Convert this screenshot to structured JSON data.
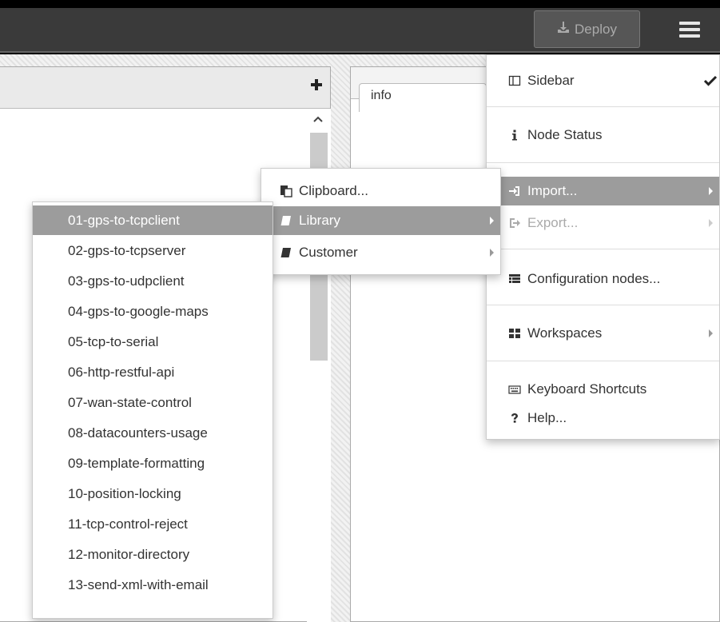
{
  "header": {
    "deploy_label": "Deploy",
    "deploy_icon": "download-tray-icon",
    "menu_icon": "hamburger-icon"
  },
  "left_panel": {
    "add_icon": "plus-icon"
  },
  "right_panel": {
    "tab_label": "info"
  },
  "main_menu": {
    "items": [
      {
        "label": "Sidebar",
        "icon": "columns-icon",
        "checked": true
      },
      {
        "label": "Node Status",
        "icon": "info-icon"
      },
      {
        "label": "Import...",
        "icon": "sign-in-icon",
        "submenu": true,
        "active": true
      },
      {
        "label": "Export...",
        "icon": "sign-out-icon",
        "submenu": true,
        "disabled": true
      },
      {
        "label": "Configuration nodes...",
        "icon": "table-icon"
      },
      {
        "label": "Workspaces",
        "icon": "grid-icon",
        "submenu": true
      },
      {
        "label": "Keyboard Shortcuts",
        "icon": "keyboard-icon"
      },
      {
        "label": "Help...",
        "icon": "question-icon"
      }
    ]
  },
  "import_menu": {
    "items": [
      {
        "label": "Clipboard...",
        "icon": "clipboard-icon"
      },
      {
        "label": "Library",
        "icon": "book-icon",
        "submenu": true,
        "active": true
      },
      {
        "label": "Customer",
        "icon": "book-icon",
        "submenu": true
      }
    ]
  },
  "library_menu": {
    "items": [
      "01-gps-to-tcpclient",
      "02-gps-to-tcpserver",
      "03-gps-to-udpclient",
      "04-gps-to-google-maps",
      "05-tcp-to-serial",
      "06-http-restful-api",
      "07-wan-state-control",
      "08-datacounters-usage",
      "09-template-formatting",
      "10-position-locking",
      "11-tcp-control-reject",
      "12-monitor-directory",
      "13-send-xml-with-email"
    ]
  },
  "colors": {
    "header_bg": "#3a3a3a",
    "menu_active_bg": "#9c9c9c",
    "deploy_bg": "#565656"
  }
}
